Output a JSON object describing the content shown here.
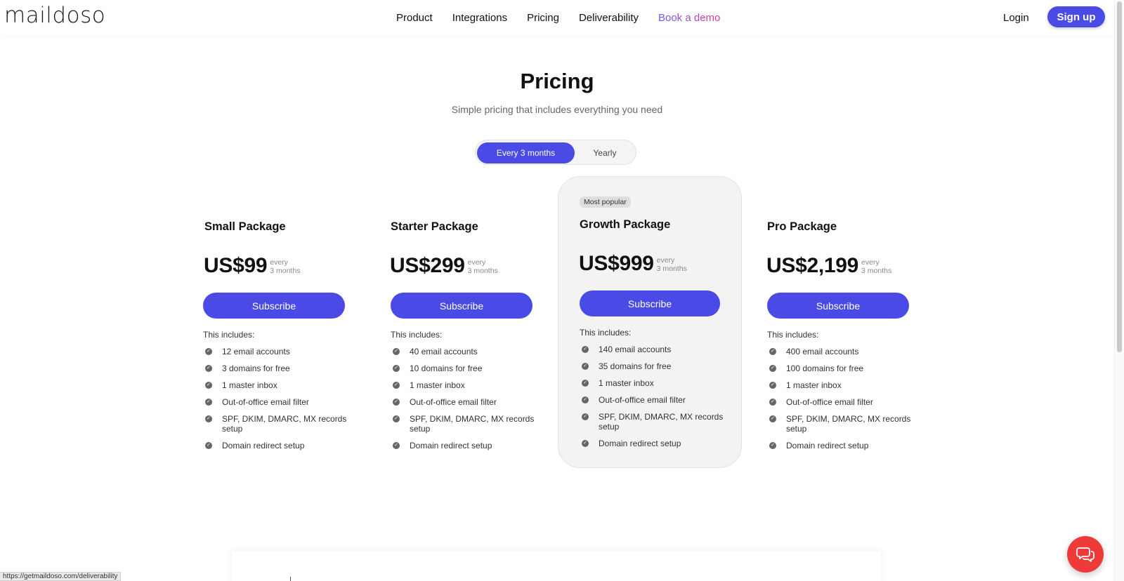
{
  "header": {
    "logo": "maildoso",
    "nav": {
      "product": "Product",
      "integrations": "Integrations",
      "pricing": "Pricing",
      "deliverability": "Deliverability",
      "demo": "Book a demo"
    },
    "login": "Login",
    "signup": "Sign up"
  },
  "main": {
    "title": "Pricing",
    "subtitle": "Simple pricing that includes everything you need",
    "toggle": {
      "active": "Every 3 months",
      "inactive": "Yearly"
    },
    "packages": [
      {
        "name": "Small Package",
        "price": "US$99",
        "period_1": "every",
        "period_2": "3 months",
        "cta": "Subscribe",
        "includes": "This includes:",
        "features": [
          "12 email accounts",
          "3 domains for free",
          "1 master inbox",
          "Out-of-office email filter",
          "SPF, DKIM, DMARC, MX records setup",
          "Domain redirect setup"
        ]
      },
      {
        "name": "Starter Package",
        "price": "US$299",
        "period_1": "every",
        "period_2": "3 months",
        "cta": "Subscribe",
        "includes": "This includes:",
        "features": [
          "40 email accounts",
          "10 domains for free",
          "1 master inbox",
          "Out-of-office email filter",
          "SPF, DKIM, DMARC, MX records setup",
          "Domain redirect setup"
        ]
      },
      {
        "badge": "Most popular",
        "name": "Growth Package",
        "price": "US$999",
        "period_1": "every",
        "period_2": "3 months",
        "cta": "Subscribe",
        "includes": "This includes:",
        "features": [
          "140 email accounts",
          "35 domains for free",
          "1 master inbox",
          "Out-of-office email filter",
          "SPF, DKIM, DMARC, MX records setup",
          "Domain redirect setup"
        ]
      },
      {
        "name": "Pro Package",
        "price": "US$2,199",
        "period_1": "every",
        "period_2": "3 months",
        "cta": "Subscribe",
        "includes": "This includes:",
        "features": [
          "400 email accounts",
          "100 domains for free",
          "1 master inbox",
          "Out-of-office email filter",
          "SPF, DKIM, DMARC, MX records setup",
          "Domain redirect setup"
        ]
      }
    ]
  },
  "status_bar": {
    "url": "https://getmaildoso.com/deliverability"
  },
  "icons": {
    "check": "check-circle-icon",
    "chat": "chat-bubble-icon"
  },
  "colors": {
    "accent": "#4a4ae6",
    "chat": "#ef3a3a"
  }
}
